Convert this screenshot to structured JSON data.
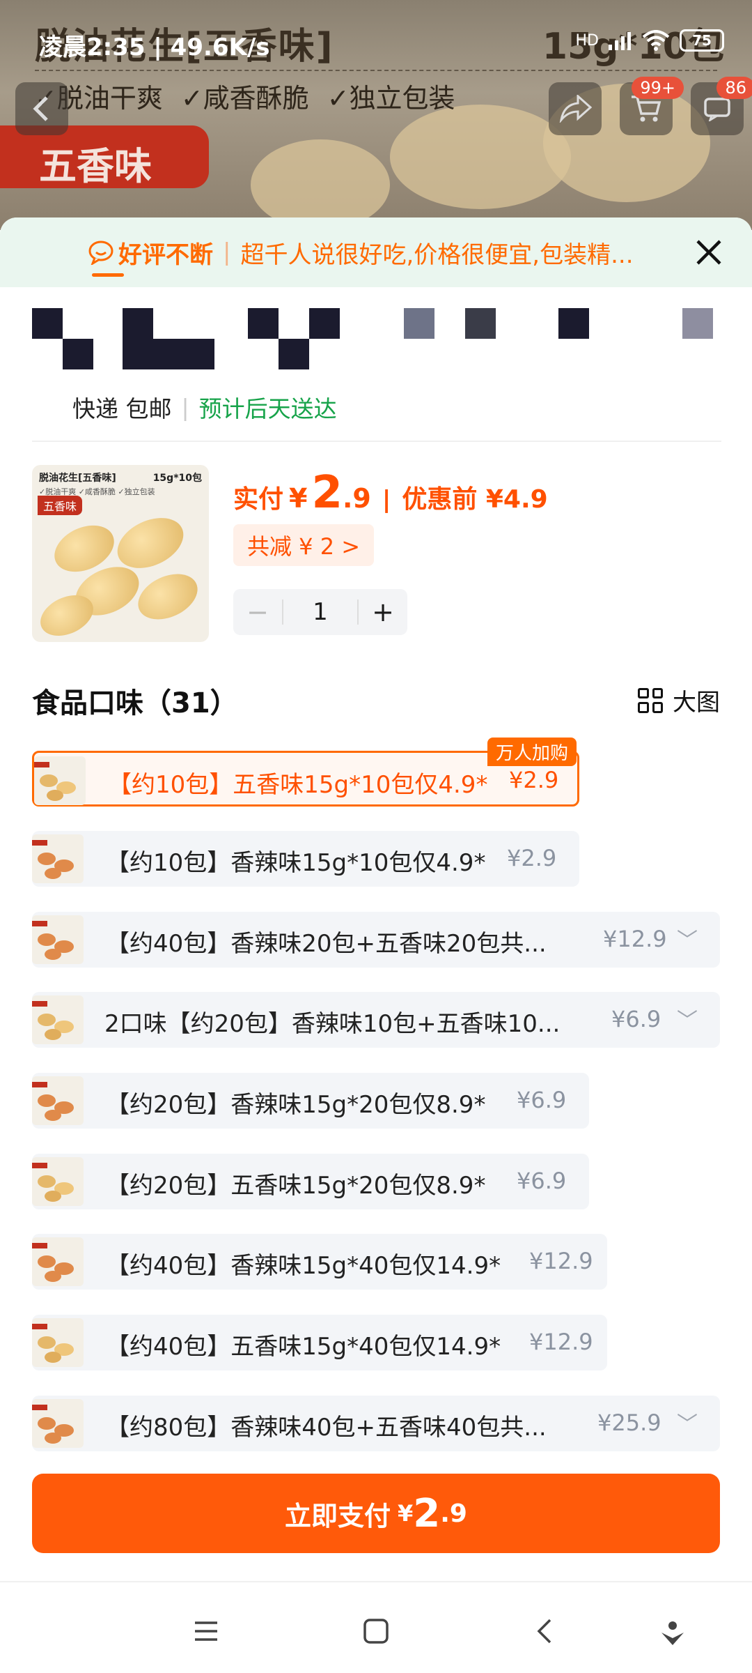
{
  "status": {
    "time": "凌晨2:35 | 49.6K/s",
    "battery": "75",
    "network": "HD"
  },
  "hero": {
    "title": "脱油花生[五香味]",
    "pack": "15g*10包",
    "features": [
      "✓脱油干爽",
      "✓咸香酥脆",
      "✓独立包装"
    ],
    "badge": "五香味"
  },
  "topbar": {
    "cart_badge": "99+",
    "msg_badge": "86"
  },
  "review": {
    "lead": "好评不断",
    "text": "超千人说很好吃,价格很便宜,包装精..."
  },
  "shipping": {
    "method": "快递 包邮",
    "estimate": "预计后天送达"
  },
  "product": {
    "thumb_title": "脱油花生[五香味]",
    "thumb_pack": "15g*10包",
    "thumb_features": "✓脱油干爽 ✓咸香酥脆 ✓独立包装",
    "thumb_badge": "五香味",
    "pay_label": "实付",
    "currency": "¥",
    "price_int": "2",
    "price_dec": ".9",
    "before_label": "优惠前 ¥4.9",
    "discount": "共减 ¥ 2 >",
    "quantity": "1",
    "minus": "−",
    "plus": "+"
  },
  "options_header": {
    "title": "食品口味（31）",
    "big_view": "大图"
  },
  "hot_tag": "万人加购",
  "options": [
    {
      "label": "【约10包】五香味15g*10包仅4.9*",
      "price": "¥2.9",
      "selected": true,
      "expand": false
    },
    {
      "label": "【约10包】香辣味15g*10包仅4.9*",
      "price": "¥2.9",
      "selected": false,
      "expand": false
    },
    {
      "label": "【约40包】香辣味20包+五香味20包共...",
      "price": "¥12.9",
      "selected": false,
      "expand": true
    },
    {
      "label": "2口味【约20包】香辣味10包+五香味10...",
      "price": "¥6.9",
      "selected": false,
      "expand": true
    },
    {
      "label": "【约20包】香辣味15g*20包仅8.9*",
      "price": "¥6.9",
      "selected": false,
      "expand": false
    },
    {
      "label": "【约20包】五香味15g*20包仅8.9*",
      "price": "¥6.9",
      "selected": false,
      "expand": false
    },
    {
      "label": "【约40包】香辣味15g*40包仅14.9*",
      "price": "¥12.9",
      "selected": false,
      "expand": false
    },
    {
      "label": "【约40包】五香味15g*40包仅14.9*",
      "price": "¥12.9",
      "selected": false,
      "expand": false
    },
    {
      "label": "【约80包】香辣味40包+五香味40包共...",
      "price": "¥25.9",
      "selected": false,
      "expand": true
    }
  ],
  "pay_button": {
    "label": "立即支付",
    "currency": "¥",
    "int": "2",
    "dec": ".9"
  }
}
